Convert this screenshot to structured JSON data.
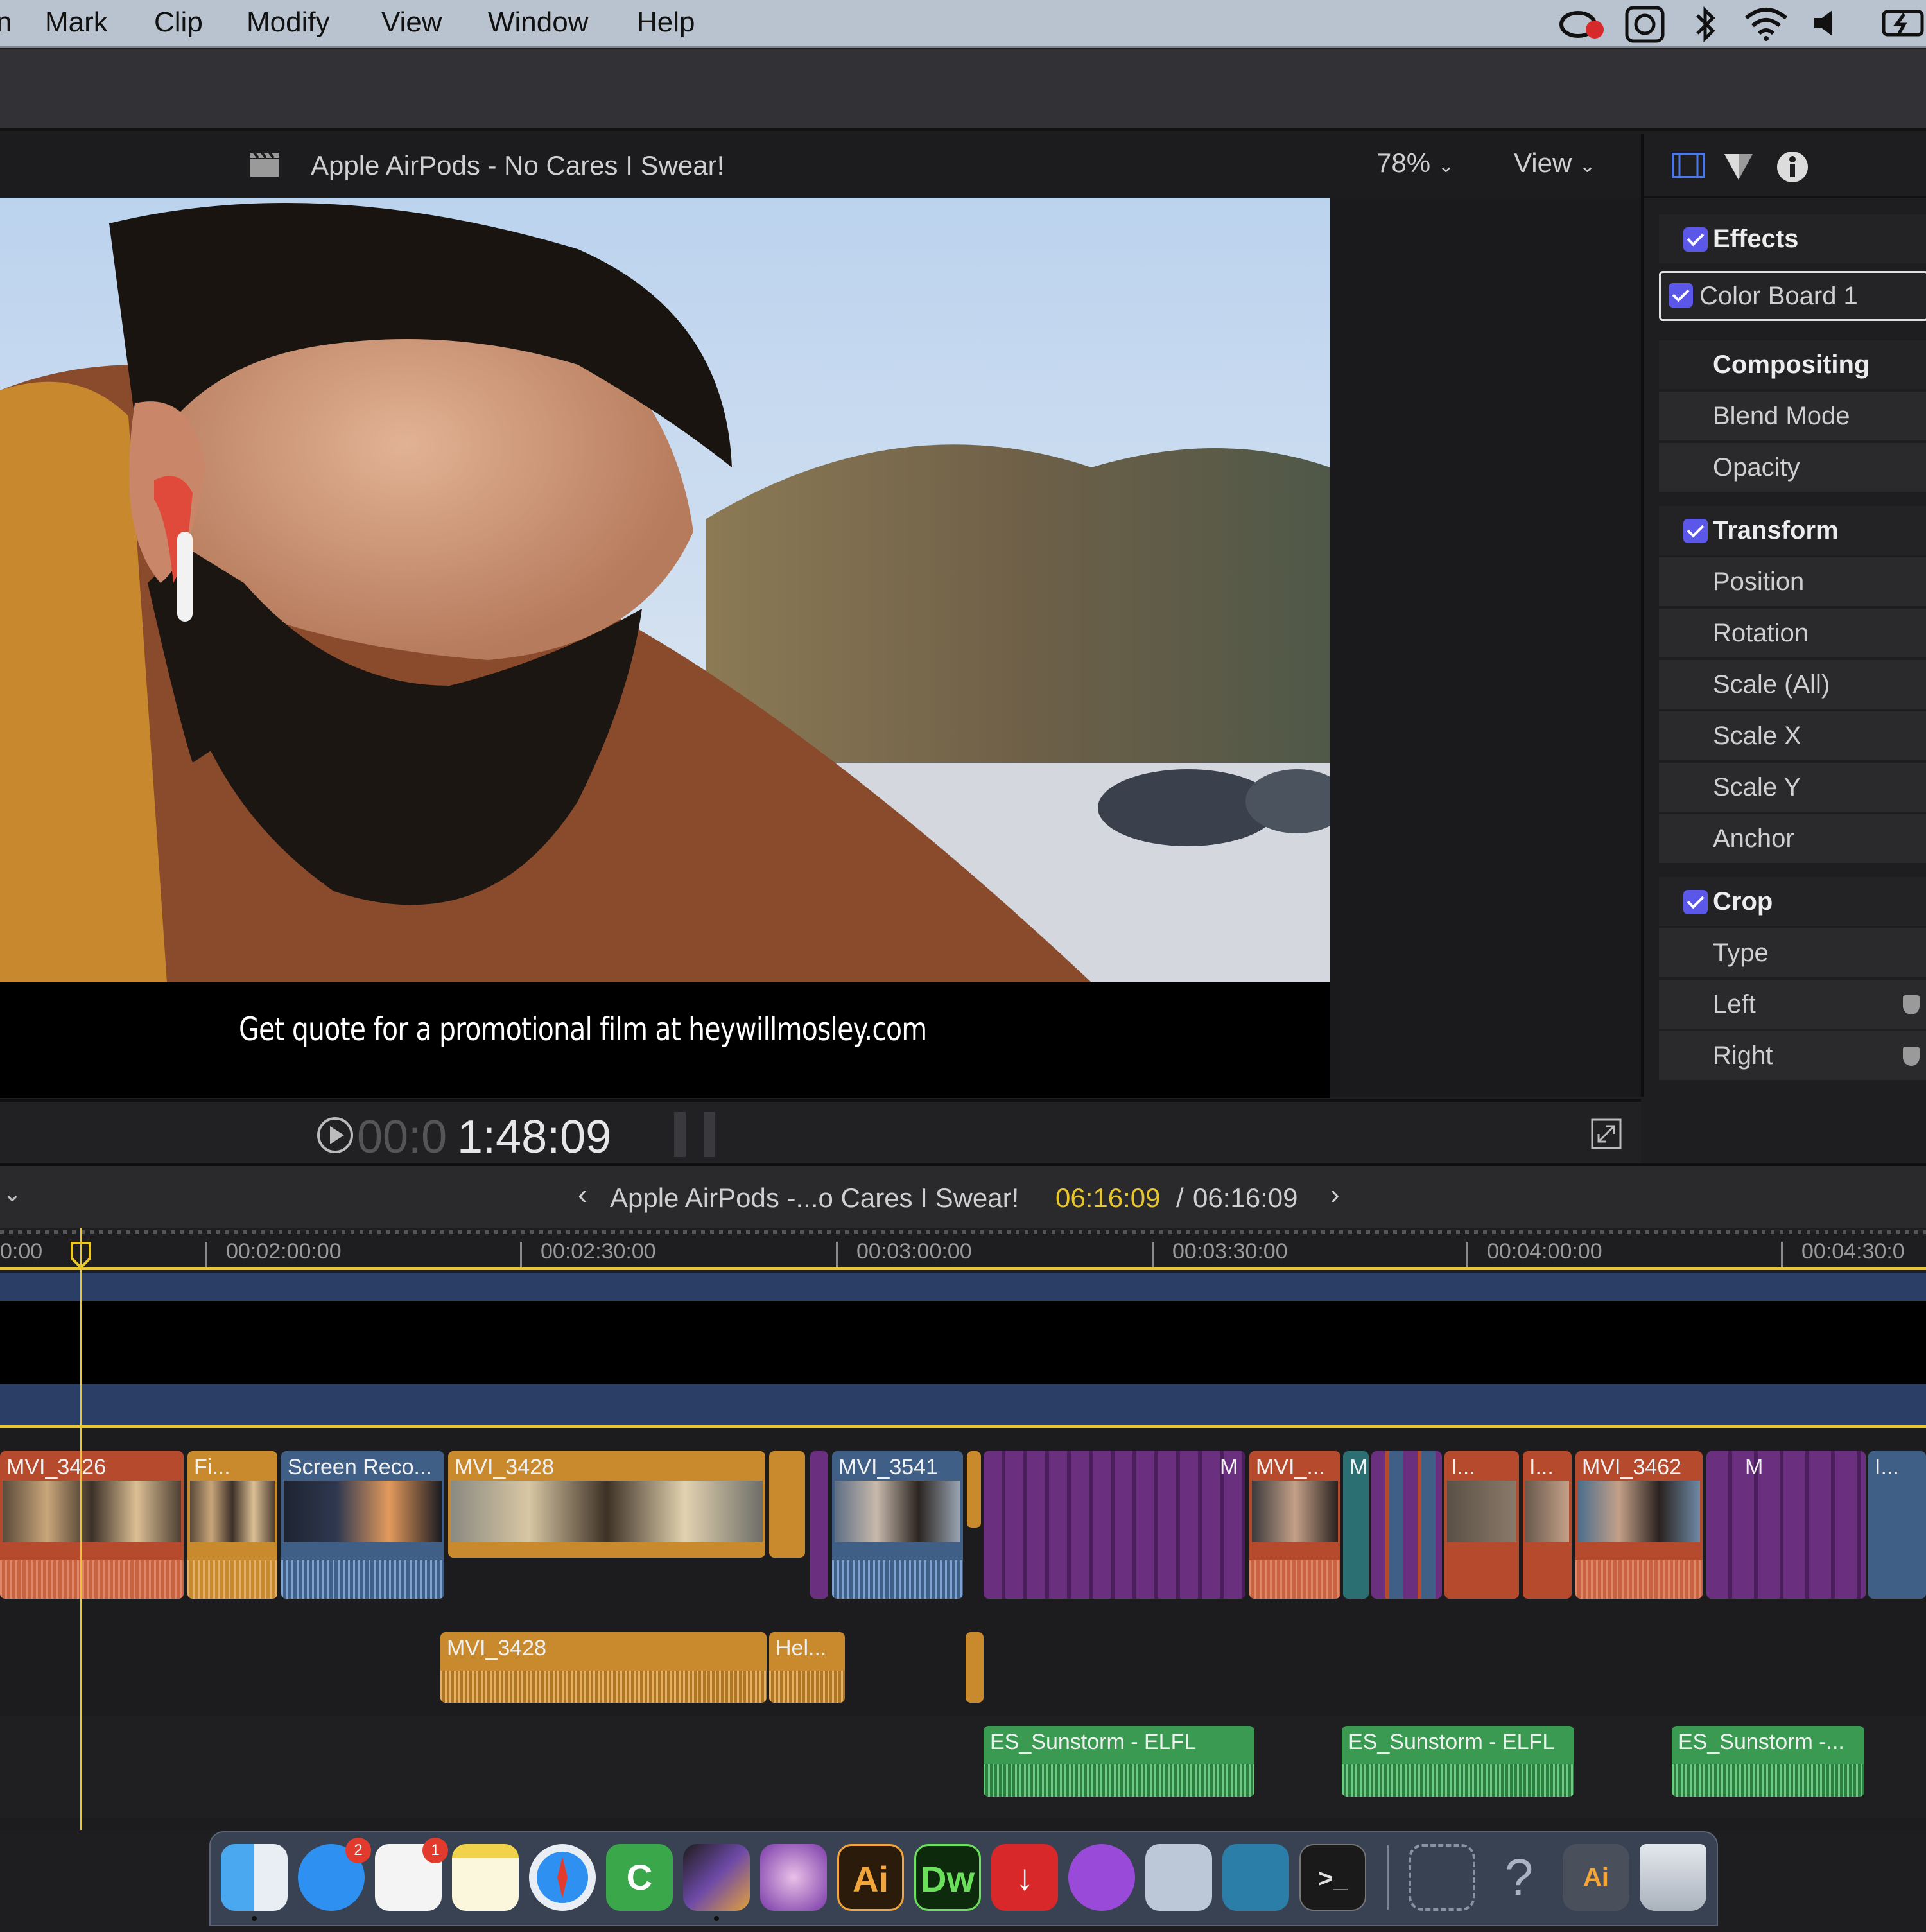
{
  "menubar": {
    "items": [
      "n",
      "Mark",
      "Clip",
      "Modify",
      "View",
      "Window",
      "Help"
    ]
  },
  "viewer": {
    "title": "Apple AirPods - No Cares I Swear!",
    "zoom": "78%",
    "view_menu": "View",
    "caption": "Get quote for a promotional film at heywillmosley.com",
    "timecode_dim": "00:0",
    "timecode_bright": "1:48:09"
  },
  "inspector": {
    "sections": [
      {
        "label": "Effects",
        "checked": true
      },
      {
        "label": "Color Board 1",
        "checked": true
      },
      {
        "label": "Compositing"
      },
      {
        "label": "Blend Mode"
      },
      {
        "label": "Opacity"
      },
      {
        "label": "Transform",
        "checked": true
      },
      {
        "label": "Position"
      },
      {
        "label": "Rotation"
      },
      {
        "label": "Scale (All)"
      },
      {
        "label": "Scale X"
      },
      {
        "label": "Scale Y"
      },
      {
        "label": "Anchor"
      },
      {
        "label": "Crop",
        "checked": true
      },
      {
        "label": "Type"
      },
      {
        "label": "Left"
      },
      {
        "label": "Right"
      }
    ]
  },
  "timeline": {
    "project_name": "Apple AirPods -...o Cares I Swear!",
    "current_time": "06:16:09",
    "separator": "/",
    "total_time": "06:16:09",
    "ruler": [
      "0:00",
      "00:02:00:00",
      "00:02:30:00",
      "00:03:00:00",
      "00:03:30:00",
      "00:04:00:00",
      "00:04:30:0"
    ],
    "clips": [
      {
        "label": "MVI_3426",
        "color": "#b54a2c"
      },
      {
        "label": "Fi...",
        "color": "#c98a2e"
      },
      {
        "label": "Screen Reco...",
        "color": "#3f5f86"
      },
      {
        "label": "MVI_3428",
        "color": "#c98a2e"
      },
      {
        "label": "MVI_3541",
        "color": "#3f5f86"
      },
      {
        "label": "M",
        "color": "#6a2f7e"
      },
      {
        "label": "MVI_...",
        "color": "#b54a2c"
      },
      {
        "label": "M",
        "color": "#2c6f72"
      },
      {
        "label": "I...",
        "color": "#b54a2c"
      },
      {
        "label": "I...",
        "color": "#b54a2c"
      },
      {
        "label": "MVI_3462",
        "color": "#b54a2c"
      },
      {
        "label": "M",
        "color": "#6a2f7e"
      },
      {
        "label": "I...",
        "color": "#3f5f86"
      }
    ],
    "audio_clips": [
      {
        "label": "MVI_3428",
        "color": "#c98a2e"
      },
      {
        "label": "Hel...",
        "color": "#c98a2e"
      }
    ],
    "music_clips": [
      {
        "label": "ES_Sunstorm - ELFL",
        "color": "#3a9a52"
      },
      {
        "label": "ES_Sunstorm - ELFL",
        "color": "#3a9a52"
      },
      {
        "label": "ES_Sunstorm -...",
        "color": "#3a9a52"
      }
    ]
  },
  "dock": {
    "items": [
      {
        "name": "finder",
        "text": ""
      },
      {
        "name": "messages",
        "text": "",
        "badge": "2"
      },
      {
        "name": "reminders",
        "text": "",
        "badge": "1"
      },
      {
        "name": "notes",
        "text": ""
      },
      {
        "name": "safari",
        "text": ""
      },
      {
        "name": "camtasia",
        "text": ""
      },
      {
        "name": "final-cut-pro",
        "text": ""
      },
      {
        "name": "motion",
        "text": ""
      },
      {
        "name": "illustrator",
        "text": "Ai"
      },
      {
        "name": "dreamweaver",
        "text": "Dw"
      },
      {
        "name": "downloader",
        "text": ""
      },
      {
        "name": "podcasts",
        "text": ""
      },
      {
        "name": "screenshot",
        "text": ""
      },
      {
        "name": "shield-app",
        "text": ""
      },
      {
        "name": "terminal",
        "text": ">_"
      },
      {
        "name": "window-app",
        "text": ""
      },
      {
        "name": "help",
        "text": "?"
      },
      {
        "name": "illustrator-doc",
        "text": "Ai"
      },
      {
        "name": "trash",
        "text": ""
      }
    ]
  },
  "colors": {
    "accent": "#5b57e8",
    "playhead": "#e8c62c",
    "timecode_yellow": "#e8c62c"
  }
}
